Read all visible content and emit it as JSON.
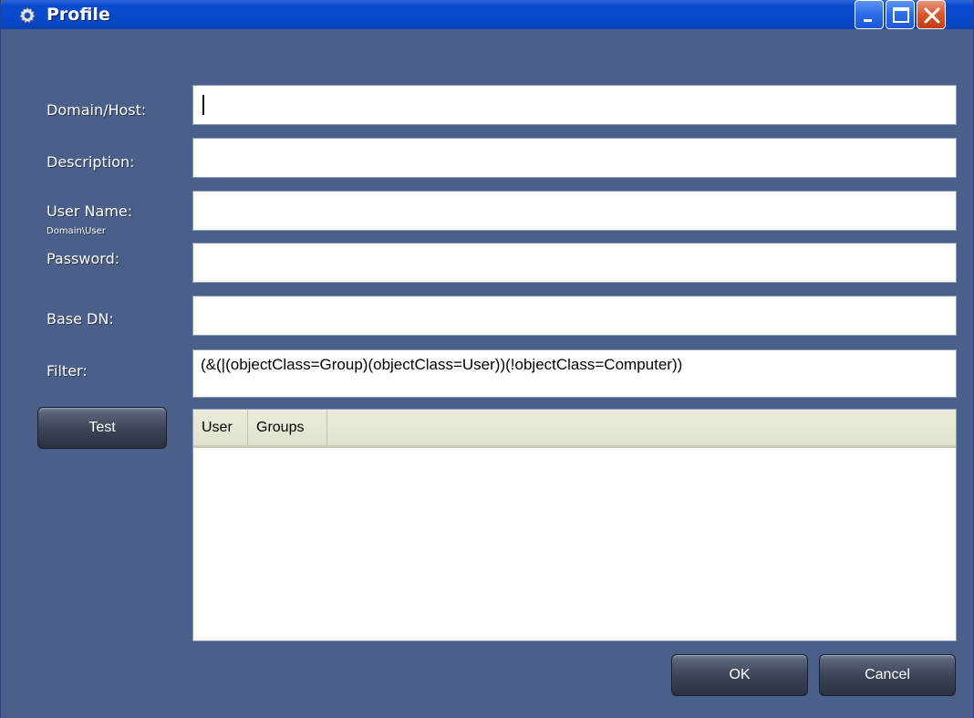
{
  "window": {
    "title": "Profile"
  },
  "icons": {
    "app": "gear-icon",
    "minimize": "minimize-icon",
    "maximize": "maximize-icon",
    "close": "close-icon"
  },
  "form": {
    "domain_label": "Domain/Host:",
    "domain_value": "",
    "description_label": "Description:",
    "description_value": "",
    "username_label": "User Name:",
    "username_hint": "Domain\\User",
    "username_value": "",
    "password_label": "Password:",
    "password_value": "",
    "basedn_label": "Base DN:",
    "basedn_value": "",
    "filter_label": "Filter:",
    "filter_value": "(&(|(objectClass=Group)(objectClass=User))(!objectClass=Computer))"
  },
  "buttons": {
    "test": "Test",
    "ok": "OK",
    "cancel": "Cancel"
  },
  "results": {
    "columns": [
      "User",
      "Groups"
    ]
  },
  "colors": {
    "window_bg": "#4a5f89",
    "titlebar": "#0848c8",
    "close_button": "#db5a30"
  }
}
